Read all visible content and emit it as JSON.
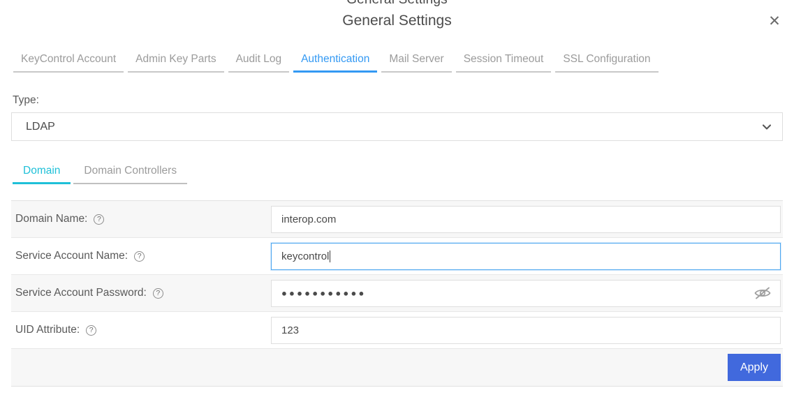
{
  "dialog": {
    "clipped_top_text": "General Settings",
    "title": "General Settings",
    "close_label": "✕"
  },
  "tabs": [
    {
      "label": "KeyControl Account",
      "active": false
    },
    {
      "label": "Admin Key Parts",
      "active": false
    },
    {
      "label": "Audit Log",
      "active": false
    },
    {
      "label": "Authentication",
      "active": true
    },
    {
      "label": "Mail Server",
      "active": false
    },
    {
      "label": "Session Timeout",
      "active": false
    },
    {
      "label": "SSL Configuration",
      "active": false
    }
  ],
  "type_section": {
    "label": "Type:",
    "selected": "LDAP",
    "options": [
      "LDAP"
    ],
    "chevron_icon": "chevron-down-icon"
  },
  "subtabs": [
    {
      "label": "Domain",
      "active": true
    },
    {
      "label": "Domain Controllers",
      "active": false
    }
  ],
  "form": {
    "rows": [
      {
        "label": "Domain Name:",
        "help_icon": "question-mark-icon",
        "value": "interop.com",
        "type": "text",
        "focused": false
      },
      {
        "label": "Service Account Name:",
        "help_icon": "question-mark-icon",
        "value": "keycontrol",
        "type": "text",
        "focused": true
      },
      {
        "label": "Service Account Password:",
        "help_icon": "question-mark-icon",
        "value": "●●●●●●●●●●●",
        "type": "password",
        "masked_char_count": 11,
        "reveal_icon": "eye-slash-icon",
        "focused": false
      },
      {
        "label": "UID Attribute:",
        "help_icon": "question-mark-icon",
        "value": "123",
        "type": "text",
        "focused": false
      }
    ],
    "apply_label": "Apply"
  },
  "colors": {
    "tab_active": "#3399f3",
    "subtab_active": "#1fc0d8",
    "apply_button": "#4169dd",
    "row_alt_background": "#f7f7f7",
    "focus_border": "#4ca6f0"
  }
}
